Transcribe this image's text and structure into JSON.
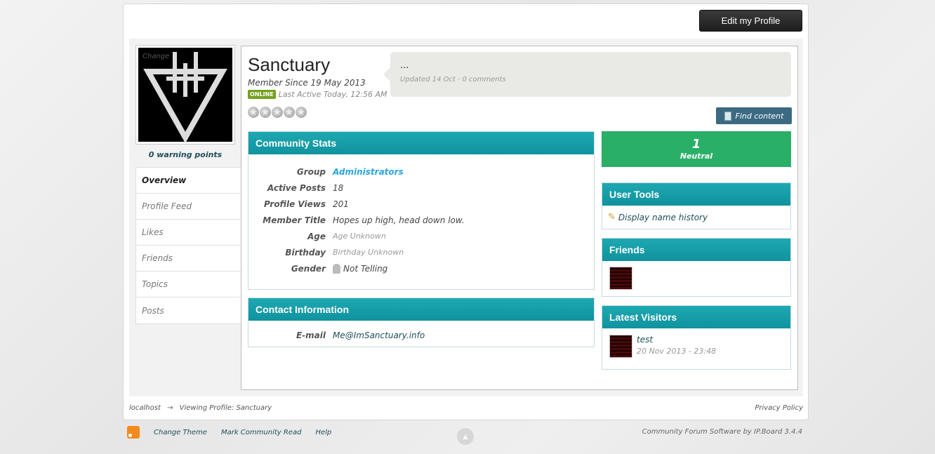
{
  "header": {
    "edit_profile_label": "Edit my Profile"
  },
  "avatar": {
    "change_label": "Change"
  },
  "warning_points": "0 warning points",
  "tabs": [
    {
      "label": "Overview",
      "active": true
    },
    {
      "label": "Profile Feed",
      "active": false
    },
    {
      "label": "Likes",
      "active": false
    },
    {
      "label": "Friends",
      "active": false
    },
    {
      "label": "Topics",
      "active": false
    },
    {
      "label": "Posts",
      "active": false
    }
  ],
  "profile": {
    "name": "Sanctuary",
    "member_since": "Member Since 19 May 2013",
    "online_badge": "ONLINE",
    "last_active": "Last Active Today, 12:56 AM",
    "rating_stars": 5
  },
  "status": {
    "text": "...",
    "meta": "Updated 14 Oct · 0 comments"
  },
  "find_content_label": "Find content",
  "community_stats": {
    "title": "Community Stats",
    "rows": [
      {
        "label": "Group",
        "value": "Administrators"
      },
      {
        "label": "Active Posts",
        "value": "18"
      },
      {
        "label": "Profile Views",
        "value": "201"
      },
      {
        "label": "Member Title",
        "value": "Hopes up high, head down low."
      },
      {
        "label": "Age",
        "value": "Age Unknown"
      },
      {
        "label": "Birthday",
        "value": "Birthday Unknown"
      },
      {
        "label": "Gender",
        "value": "Not Telling"
      }
    ]
  },
  "contact": {
    "title": "Contact Information",
    "email_label": "E-mail",
    "email_value": "Me@ImSanctuary.info"
  },
  "reputation": {
    "value": "1",
    "label": "Neutral"
  },
  "user_tools": {
    "title": "User Tools",
    "display_name_history": "Display name history"
  },
  "friends": {
    "title": "Friends"
  },
  "latest_visitors": {
    "title": "Latest Visitors",
    "visitor_name": "test",
    "visitor_time": "20 Nov 2013 - 23:48"
  },
  "breadcrumb": {
    "home": "localhost",
    "current": "Viewing Profile: Sanctuary"
  },
  "privacy_policy": "Privacy Policy",
  "footer": {
    "change_theme": "Change Theme",
    "mark_read": "Mark Community Read",
    "help": "Help",
    "powered_by": "Community Forum Software by IP.Board 3.4.4"
  },
  "colors": {
    "accent": "#10939e",
    "reputation": "#2aaf67",
    "online": "#74a01f",
    "find_button": "#3b6a82"
  }
}
